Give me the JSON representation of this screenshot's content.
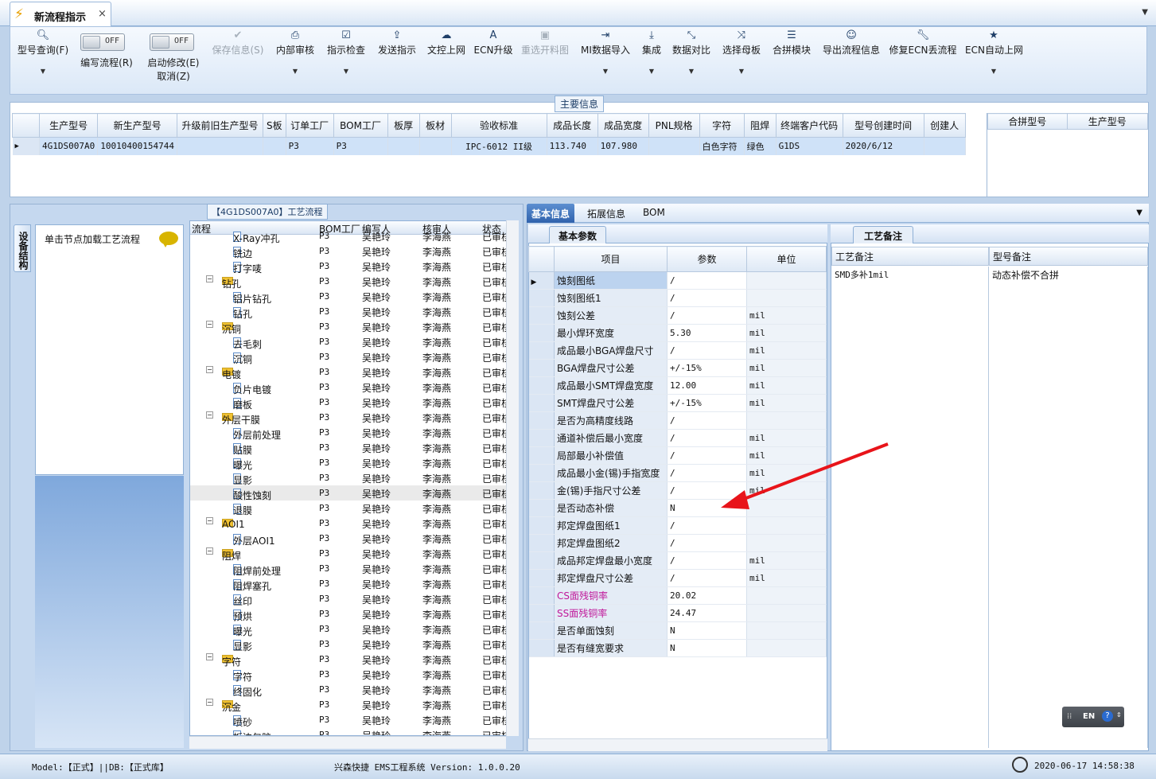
{
  "tab": {
    "title": "新流程指示",
    "close": "×"
  },
  "ribbon": {
    "buttons": [
      {
        "label": "型号查询(F)",
        "icon": "search-icon"
      },
      {
        "label": "编写流程(R)",
        "toggle": "OFF"
      },
      {
        "label": "启动修改(E)",
        "label2": "取消(Z)",
        "toggle": "OFF"
      },
      {
        "label": "保存信息(S)",
        "icon": "check-icon"
      },
      {
        "label": "内部审核",
        "icon": "printer-icon"
      },
      {
        "label": "指示检查",
        "icon": "checkbox-icon"
      },
      {
        "label": "发送指示",
        "icon": "upload-icon"
      },
      {
        "label": "文控上网",
        "icon": "cloud-upload-icon"
      },
      {
        "label": "ECN升级",
        "icon": "font-icon"
      },
      {
        "label": "重选开料图",
        "icon": "image-icon"
      },
      {
        "label": "MI数据导入",
        "icon": "import-icon"
      },
      {
        "label": "集成",
        "icon": "download-icon"
      },
      {
        "label": "数据对比",
        "icon": "compress-icon"
      },
      {
        "label": "选择母板",
        "icon": "shuffle-icon"
      },
      {
        "label": "合拼模块",
        "icon": "list-icon"
      },
      {
        "label": "导出流程信息",
        "icon": "smile-icon"
      },
      {
        "label": "修复ECN丢流程",
        "icon": "wrench-icon"
      },
      {
        "label": "ECN自动上网",
        "icon": "star-icon"
      }
    ]
  },
  "main_info": {
    "title": "主要信息",
    "columns": [
      "生产型号",
      "新生产型号",
      "升级前旧生产型号",
      "S板",
      "订单工厂",
      "BOM工厂",
      "板厚",
      "板材",
      "验收标准",
      "成品长度",
      "成品宽度",
      "PNL规格",
      "字符",
      "阻焊",
      "终端客户代码",
      "型号创建时间",
      "创建人"
    ],
    "row": [
      "4G1DS007A0",
      "10010400154744",
      "",
      "",
      "P3",
      "P3",
      "",
      "",
      "IPC-6012 II级",
      "113.740",
      "107.980",
      "",
      "白色字符",
      "绿色",
      "G1DS",
      "2020/6/12",
      ""
    ],
    "merge_columns": [
      "合拼型号",
      "生产型号"
    ]
  },
  "flow_panel": {
    "title": "【4G1DS007A0】工艺流程",
    "side_tab": "设备结构",
    "node_hint": "单击节点加载工艺流程",
    "columns": [
      "流程",
      "BOM工厂",
      "编写人",
      "核审人",
      "状态"
    ],
    "rows": [
      {
        "name": "X-Ray冲孔",
        "level": 1,
        "bom": "P3",
        "author": "吴艳玲",
        "reviewer": "李海燕",
        "status": "已审核"
      },
      {
        "name": "铣边",
        "level": 1,
        "bom": "P3",
        "author": "吴艳玲",
        "reviewer": "李海燕",
        "status": "已审核"
      },
      {
        "name": "打字唛",
        "level": 1,
        "bom": "P3",
        "author": "吴艳玲",
        "reviewer": "李海燕",
        "status": "已审核"
      },
      {
        "name": "钻孔",
        "level": 0,
        "bom": "P3",
        "author": "吴艳玲",
        "reviewer": "李海燕",
        "status": "已审核"
      },
      {
        "name": "铝片钻孔",
        "level": 1,
        "bom": "P3",
        "author": "吴艳玲",
        "reviewer": "李海燕",
        "status": "已审核"
      },
      {
        "name": "钻孔",
        "level": 1,
        "bom": "P3",
        "author": "吴艳玲",
        "reviewer": "李海燕",
        "status": "已审核"
      },
      {
        "name": "沉铜",
        "level": 0,
        "bom": "P3",
        "author": "吴艳玲",
        "reviewer": "李海燕",
        "status": "已审核"
      },
      {
        "name": "去毛刺",
        "level": 1,
        "bom": "P3",
        "author": "吴艳玲",
        "reviewer": "李海燕",
        "status": "已审核"
      },
      {
        "name": "沉铜",
        "level": 1,
        "bom": "P3",
        "author": "吴艳玲",
        "reviewer": "李海燕",
        "status": "已审核"
      },
      {
        "name": "电镀",
        "level": 0,
        "bom": "P3",
        "author": "吴艳玲",
        "reviewer": "李海燕",
        "status": "已审核"
      },
      {
        "name": "负片电镀",
        "level": 1,
        "bom": "P3",
        "author": "吴艳玲",
        "reviewer": "李海燕",
        "status": "已审核"
      },
      {
        "name": "磨板",
        "level": 1,
        "bom": "P3",
        "author": "吴艳玲",
        "reviewer": "李海燕",
        "status": "已审核"
      },
      {
        "name": "外层干膜",
        "level": 0,
        "bom": "P3",
        "author": "吴艳玲",
        "reviewer": "李海燕",
        "status": "已审核"
      },
      {
        "name": "外层前处理",
        "level": 1,
        "bom": "P3",
        "author": "吴艳玲",
        "reviewer": "李海燕",
        "status": "已审核"
      },
      {
        "name": "贴膜",
        "level": 1,
        "bom": "P3",
        "author": "吴艳玲",
        "reviewer": "李海燕",
        "status": "已审核"
      },
      {
        "name": "曝光",
        "level": 1,
        "bom": "P3",
        "author": "吴艳玲",
        "reviewer": "李海燕",
        "status": "已审核"
      },
      {
        "name": "显影",
        "level": 1,
        "bom": "P3",
        "author": "吴艳玲",
        "reviewer": "李海燕",
        "status": "已审核"
      },
      {
        "name": "酸性蚀刻",
        "level": 1,
        "bom": "P3",
        "author": "吴艳玲",
        "reviewer": "李海燕",
        "status": "已审核",
        "selected": true
      },
      {
        "name": "退膜",
        "level": 1,
        "bom": "P3",
        "author": "吴艳玲",
        "reviewer": "李海燕",
        "status": "已审核"
      },
      {
        "name": "AOI1",
        "level": 0,
        "bom": "P3",
        "author": "吴艳玲",
        "reviewer": "李海燕",
        "status": "已审核"
      },
      {
        "name": "外层AOI1",
        "level": 1,
        "bom": "P3",
        "author": "吴艳玲",
        "reviewer": "李海燕",
        "status": "已审核"
      },
      {
        "name": "阻焊",
        "level": 0,
        "bom": "P3",
        "author": "吴艳玲",
        "reviewer": "李海燕",
        "status": "已审核"
      },
      {
        "name": "阻焊前处理",
        "level": 1,
        "bom": "P3",
        "author": "吴艳玲",
        "reviewer": "李海燕",
        "status": "已审核"
      },
      {
        "name": "阻焊塞孔",
        "level": 1,
        "bom": "P3",
        "author": "吴艳玲",
        "reviewer": "李海燕",
        "status": "已审核"
      },
      {
        "name": "丝印",
        "level": 1,
        "bom": "P3",
        "author": "吴艳玲",
        "reviewer": "李海燕",
        "status": "已审核"
      },
      {
        "name": "预烘",
        "level": 1,
        "bom": "P3",
        "author": "吴艳玲",
        "reviewer": "李海燕",
        "status": "已审核"
      },
      {
        "name": "曝光",
        "level": 1,
        "bom": "P3",
        "author": "吴艳玲",
        "reviewer": "李海燕",
        "status": "已审核"
      },
      {
        "name": "显影",
        "level": 1,
        "bom": "P3",
        "author": "吴艳玲",
        "reviewer": "李海燕",
        "status": "已审核"
      },
      {
        "name": "字符",
        "level": 0,
        "bom": "P3",
        "author": "吴艳玲",
        "reviewer": "李海燕",
        "status": "已审核"
      },
      {
        "name": "字符",
        "level": 1,
        "bom": "P3",
        "author": "吴艳玲",
        "reviewer": "李海燕",
        "status": "已审核"
      },
      {
        "name": "终固化",
        "level": 1,
        "bom": "P3",
        "author": "吴艳玲",
        "reviewer": "李海燕",
        "status": "已审核"
      },
      {
        "name": "沉金",
        "level": 0,
        "bom": "P3",
        "author": "吴艳玲",
        "reviewer": "李海燕",
        "status": "已审核"
      },
      {
        "name": "喷砂",
        "level": 1,
        "bom": "P3",
        "author": "吴艳玲",
        "reviewer": "李海燕",
        "status": "已审核"
      },
      {
        "name": "板边包胶",
        "level": 1,
        "bom": "P3",
        "author": "吴艳玲",
        "reviewer": "李海燕",
        "status": "已审核"
      }
    ]
  },
  "right_tabs": [
    "基本信息",
    "拓展信息",
    "BOM"
  ],
  "params": {
    "tab": "基本参数",
    "columns": [
      "项目",
      "参数",
      "单位"
    ],
    "rows": [
      {
        "item": "蚀刻图纸",
        "value": "/",
        "unit": "",
        "selected": true
      },
      {
        "item": "蚀刻图纸1",
        "value": "/",
        "unit": ""
      },
      {
        "item": "蚀刻公差",
        "value": "/",
        "unit": "mil"
      },
      {
        "item": "最小焊环宽度",
        "value": "5.30",
        "unit": "mil"
      },
      {
        "item": "成品最小BGA焊盘尺寸",
        "value": "/",
        "unit": "mil"
      },
      {
        "item": "BGA焊盘尺寸公差",
        "value": "+/-15%",
        "unit": "mil"
      },
      {
        "item": "成品最小SMT焊盘宽度",
        "value": "12.00",
        "unit": "mil"
      },
      {
        "item": "SMT焊盘尺寸公差",
        "value": "+/-15%",
        "unit": "mil"
      },
      {
        "item": "是否为高精度线路",
        "value": "/",
        "unit": ""
      },
      {
        "item": "通道补偿后最小宽度",
        "value": "/",
        "unit": "mil"
      },
      {
        "item": "局部最小补偿值",
        "value": "/",
        "unit": "mil"
      },
      {
        "item": "成品最小金(锡)手指宽度",
        "value": "/",
        "unit": "mil"
      },
      {
        "item": "金(锡)手指尺寸公差",
        "value": "/",
        "unit": "mil"
      },
      {
        "item": "是否动态补偿",
        "value": "N",
        "unit": ""
      },
      {
        "item": "邦定焊盘图纸1",
        "value": "/",
        "unit": ""
      },
      {
        "item": "邦定焊盘图纸2",
        "value": "/",
        "unit": ""
      },
      {
        "item": "成品邦定焊盘最小宽度",
        "value": "/",
        "unit": "mil"
      },
      {
        "item": "邦定焊盘尺寸公差",
        "value": "/",
        "unit": "mil"
      },
      {
        "item": "CS面残铜率",
        "value": "20.02",
        "unit": "",
        "highlight": true
      },
      {
        "item": "SS面残铜率",
        "value": "24.47",
        "unit": "",
        "highlight": true
      },
      {
        "item": "是否单面蚀刻",
        "value": "N",
        "unit": ""
      },
      {
        "item": "是否有缝宽要求",
        "value": "N",
        "unit": ""
      }
    ]
  },
  "notes": {
    "tab": "工艺备注",
    "columns": [
      "工艺备注",
      "型号备注"
    ],
    "process_note": "SMD多补1mil",
    "model_note": "动态补偿不合拼"
  },
  "ime": {
    "label": "EN"
  },
  "status": {
    "left": "Model:【正式】||DB:【正式库】",
    "center": "兴森快捷 EMS工程系统 Version: 1.0.0.20",
    "datetime": "2020-06-17 14:58:38"
  },
  "colors": {
    "accent": "#2f62ad",
    "highlight_text": "#c0189a",
    "arrow": "#e8141a"
  }
}
